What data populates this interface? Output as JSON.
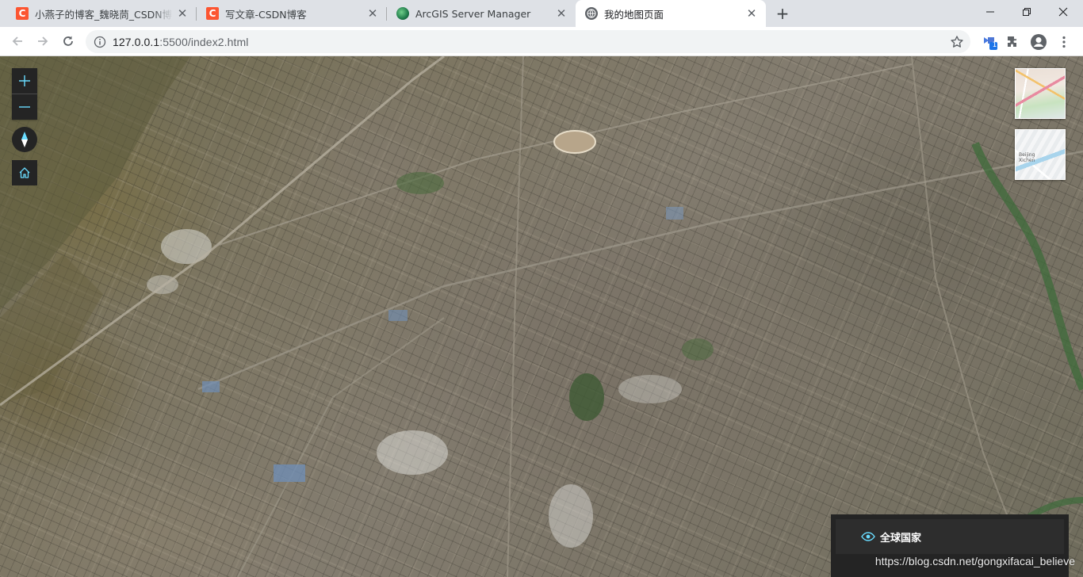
{
  "browser": {
    "tabs": [
      {
        "title": "小燕子的博客_魏晓茼_CSDN博客",
        "favicon": "csdn-icon",
        "active": false
      },
      {
        "title": "写文章-CSDN博客",
        "favicon": "csdn-icon",
        "active": false
      },
      {
        "title": "ArcGIS Server Manager",
        "favicon": "arcgis-icon",
        "active": false
      },
      {
        "title": "我的地图页面",
        "favicon": "globe-icon",
        "active": true
      }
    ],
    "new_tab_label": "+",
    "favicon_letter": "C",
    "url": {
      "host": "127.0.0.1",
      "rest": ":5500/index2.html"
    },
    "extension_badge": "1",
    "colors": {
      "tabbar_bg": "#dee1e6",
      "csdn_red": "#fc5531",
      "accent_blue": "#1a73e8"
    }
  },
  "map": {
    "widgets": {
      "zoom_in": "zoom-in-icon",
      "zoom_out": "zoom-out-icon",
      "compass": "compass-icon",
      "home": "home-icon"
    },
    "basemaps": [
      {
        "name": "streets-thumbnail",
        "label_lines": []
      },
      {
        "name": "topo-thumbnail",
        "label_lines": [
          "Beijing",
          "Xichen"
        ]
      }
    ],
    "layer_list": {
      "items": [
        {
          "label": "全球国家",
          "visible": true
        }
      ]
    },
    "watermark": "https://blog.csdn.net/gongxifacai_believe",
    "colors": {
      "widget_bg": "#242424",
      "eye_icon": "#69dcff"
    }
  }
}
